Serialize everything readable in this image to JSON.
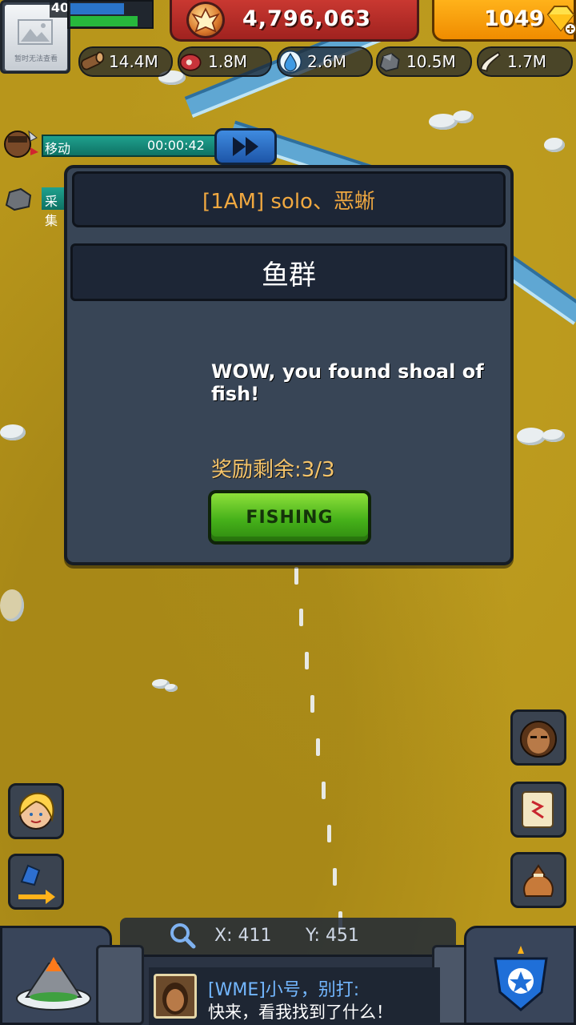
{
  "player": {
    "level": "40",
    "avatar_placeholder": "暂时无法查看",
    "exp_fill": 0.66,
    "stamina_fill": 0.82
  },
  "currency": {
    "gold": "4,796,063",
    "gems": "1049"
  },
  "resources": [
    {
      "name": "wood",
      "icon": "log-icon",
      "value": "14.4M"
    },
    {
      "name": "meat",
      "icon": "meat-icon",
      "value": "1.8M"
    },
    {
      "name": "water",
      "icon": "water-drop-icon",
      "value": "2.6M"
    },
    {
      "name": "stone",
      "icon": "stone-icon",
      "value": "10.5M"
    },
    {
      "name": "bone",
      "icon": "bone-icon",
      "value": "1.7M"
    }
  ],
  "march_queue": [
    {
      "label": "移动",
      "time": "00:00:42"
    },
    {
      "label": "采集"
    }
  ],
  "dialog": {
    "owner": "[1AM] solo、恶蜥",
    "title": "鱼群",
    "message": "WOW, you found shoal of fish!",
    "reward_label": "奖励剩余:3/3",
    "button_label": "FISHING"
  },
  "coords": {
    "x_label": "X:",
    "x": "411",
    "y_label": "Y:",
    "y": "451"
  },
  "chat": {
    "sender": "[WME]小号，别打:",
    "message": "快来，看我找到了什么！"
  },
  "colors": {
    "gold_panel": "#c93831",
    "gem_panel": "#ffb21a",
    "dialog_bg": "#384556",
    "owner_text": "#f0a840",
    "reward_text": "#f5c46a",
    "fishing_button": "#46b11a",
    "chat_sender": "#73b7ff"
  }
}
